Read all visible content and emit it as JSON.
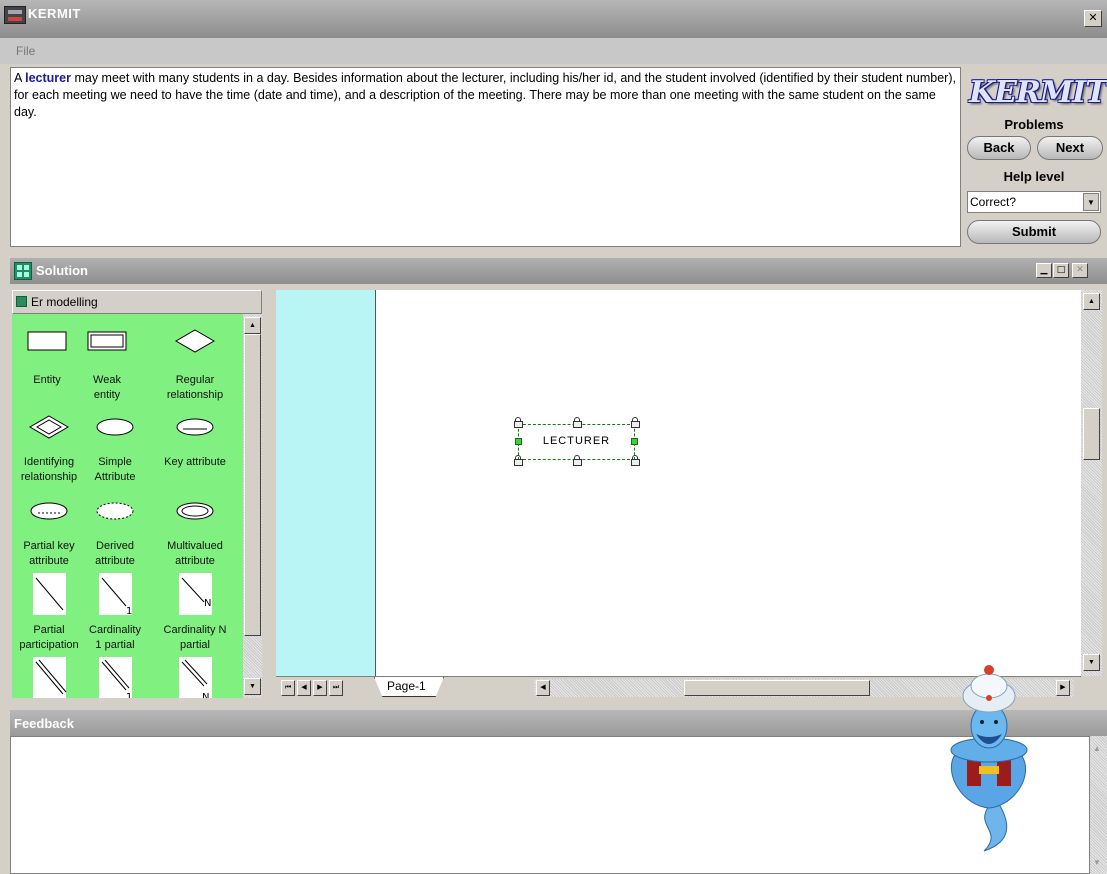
{
  "window": {
    "title": "KERMIT",
    "close_glyph": "✕"
  },
  "menu": {
    "file": "File"
  },
  "problem": {
    "prefix": "A ",
    "highlight": "lecturer",
    "text": " may meet with many students in a day. Besides information about the lecturer, including his/her id, and the student involved (identified by their student number), for each meeting we need to have the time (date and time), and a description of the meeting. There may be more than one meeting with the same student on the same day."
  },
  "sidebar": {
    "logo": "KERMIT",
    "problems_label": "Problems",
    "back": "Back",
    "next": "Next",
    "help_label": "Help level",
    "help_value": "Correct?",
    "submit": "Submit"
  },
  "solution": {
    "title": "Solution",
    "stencil_title": "Er modelling",
    "shapes": [
      {
        "label": "Entity",
        "icon": "entity-icon"
      },
      {
        "label": "Weak entity",
        "icon": "weak-entity-icon"
      },
      {
        "label": "Regular relationship",
        "icon": "relationship-icon"
      },
      {
        "label": "Identifying relationship",
        "icon": "identifying-relationship-icon"
      },
      {
        "label": "Simple Attribute",
        "icon": "simple-attribute-icon"
      },
      {
        "label": "Key attribute",
        "icon": "key-attribute-icon"
      },
      {
        "label": "Partial key attribute",
        "icon": "partial-key-attribute-icon"
      },
      {
        "label": "Derived attribute",
        "icon": "derived-attribute-icon"
      },
      {
        "label": "Multivalued attribute",
        "icon": "multivalued-attribute-icon"
      },
      {
        "label": "Partial participation",
        "icon": "partial-participation-icon"
      },
      {
        "label": "Cardinality 1 partial",
        "icon": "cardinality-1-partial-icon"
      },
      {
        "label": "Cardinality N partial",
        "icon": "cardinality-n-partial-icon"
      }
    ],
    "entity_label": "LECTURER",
    "page_tab": "Page-1"
  },
  "feedback": {
    "title": "Feedback"
  },
  "colors": {
    "stencil_bg": "#80f080",
    "canvas_margin": "#b9f5f5",
    "accent": "#1a1aa0"
  }
}
